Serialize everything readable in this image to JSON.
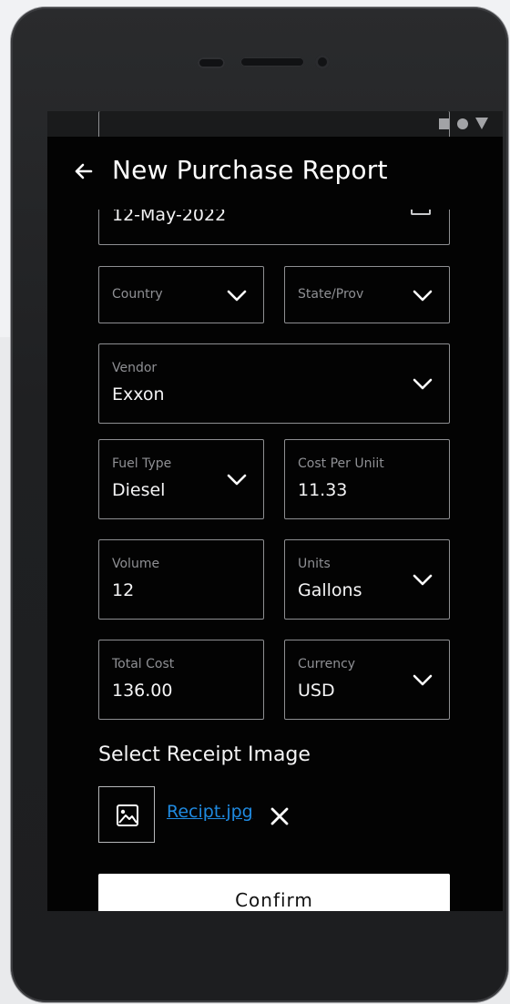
{
  "app": {
    "title": "New Purchase Report"
  },
  "form": {
    "date": {
      "value": "12-May-2022"
    },
    "country": {
      "placeholder": "Country"
    },
    "state": {
      "placeholder": "State/Prov"
    },
    "vendor": {
      "label": "Vendor",
      "value": "Exxon"
    },
    "fuel_type": {
      "label": "Fuel Type",
      "value": "Diesel"
    },
    "cost_per_unit": {
      "label": "Cost Per Uniit",
      "value": "11.33"
    },
    "volume": {
      "label": "Volume",
      "value": "12"
    },
    "units": {
      "label": "Units",
      "value": "Gallons"
    },
    "total_cost": {
      "label": "Total Cost",
      "value": "136.00"
    },
    "currency": {
      "label": "Currency",
      "value": "USD"
    }
  },
  "receipt": {
    "title": "Select Receipt Image",
    "file_name": "Recipt.jpg",
    "remove_icon": "close-icon"
  },
  "actions": {
    "confirm_label": "Confirm"
  },
  "icons": {
    "back": "arrow-left-icon",
    "dropdown": "chevron-down-icon",
    "image": "image-icon",
    "status_square": "square-icon",
    "status_circle": "circle-icon",
    "status_triangle": "signal-triangle-icon"
  },
  "colors": {
    "screen_background": "#030303",
    "field_border": "#8e8f92",
    "link": "#1f8ae0",
    "button_background": "#ffffff"
  }
}
